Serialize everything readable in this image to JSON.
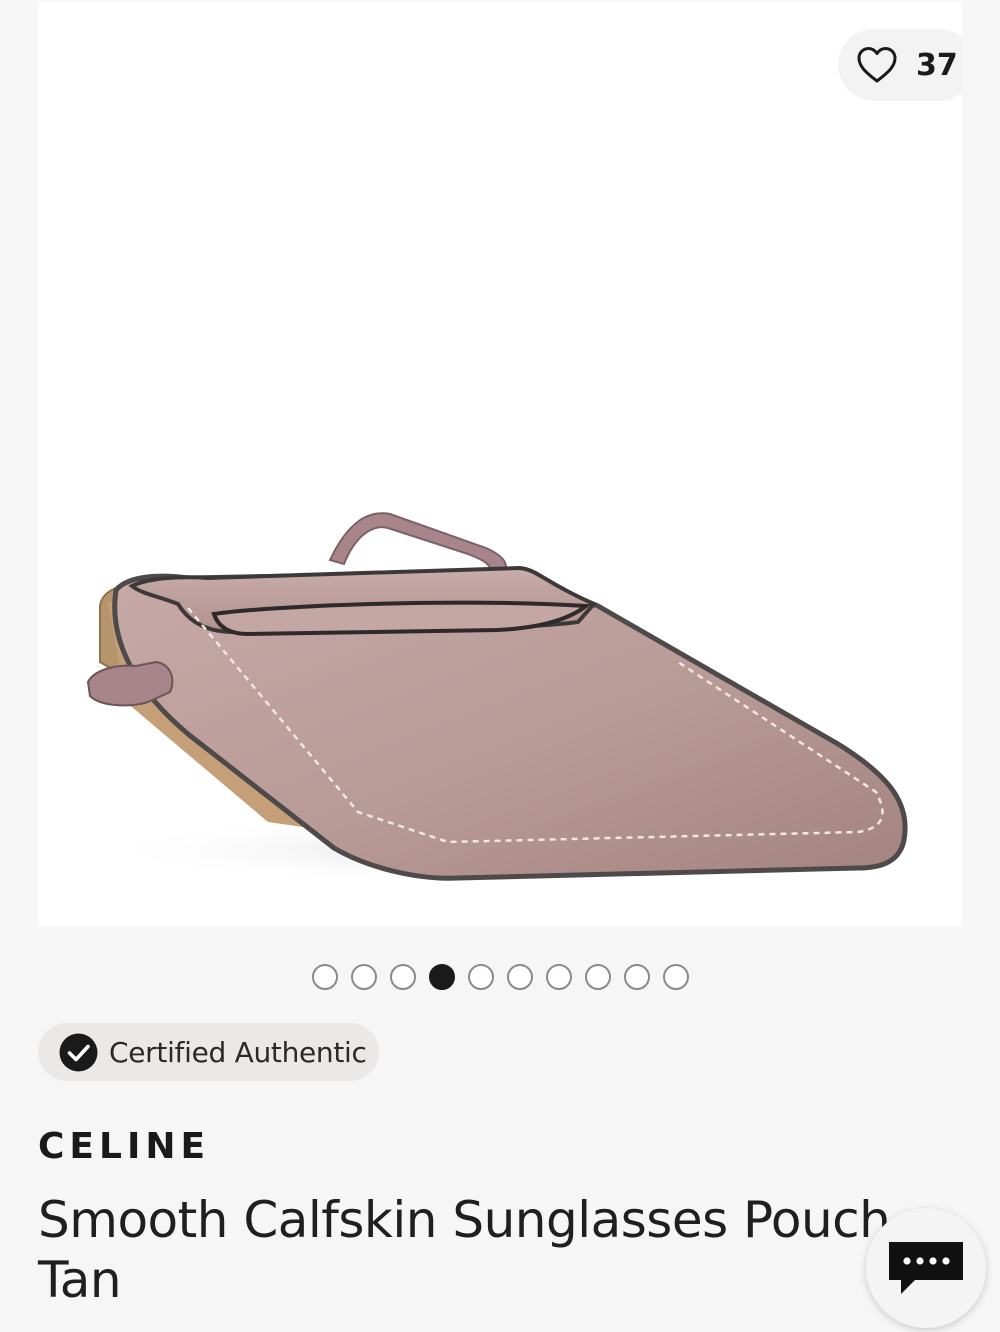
{
  "product": {
    "image_alt": "Celine smooth calfskin sunglasses pouch",
    "like_count": "37",
    "brand": "CELINE",
    "title": "Smooth Calfskin Sunglasses Pouch Tan"
  },
  "badge": {
    "label": "Certified Authentic"
  },
  "carousel": {
    "total": 10,
    "active_index": 3
  },
  "icons": {
    "like": "heart-outline-icon",
    "authentic": "check-circle-icon",
    "chat": "chat-bubble-icon"
  },
  "colors": {
    "background": "#f6f6f6",
    "image_background": "#ffffff",
    "pouch_leather": "#b89a98",
    "text": "#1a1a1a",
    "badge_background": "#ebe8e8"
  }
}
